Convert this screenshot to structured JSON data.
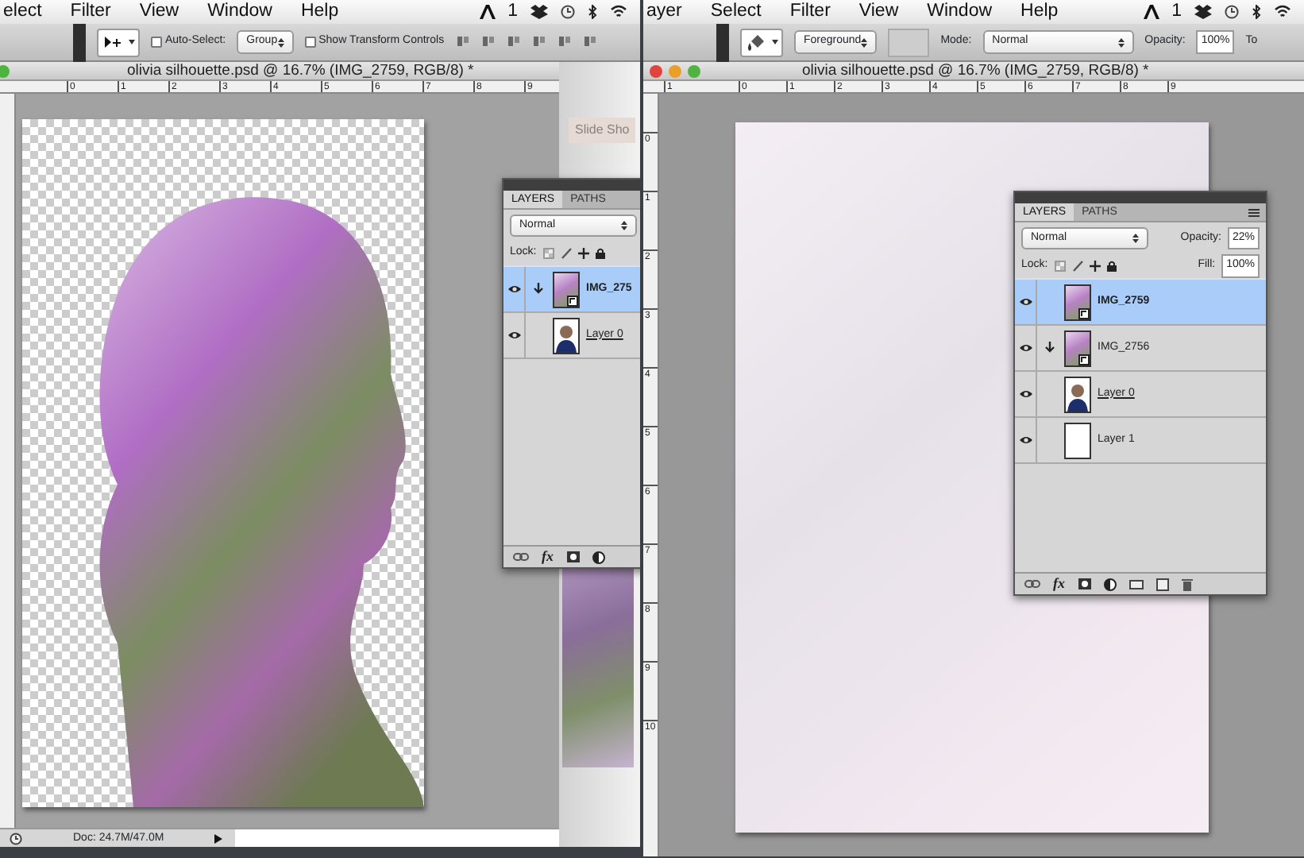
{
  "left_window": {
    "menu_bar": {
      "items": [
        "elect",
        "Filter",
        "View",
        "Window",
        "Help"
      ],
      "badge": "1"
    },
    "options_bar": {
      "controls": [
        {
          "kind": "movetool"
        },
        {
          "kind": "checkbox",
          "label": "Auto-Select:",
          "checked": false
        },
        {
          "kind": "dropdown",
          "value": "Group"
        },
        {
          "kind": "checkbox",
          "label": "Show Transform Controls",
          "checked": false
        }
      ]
    },
    "document": {
      "title": "olivia silhouette.psd @ 16.7% (IMG_2759, RGB/8) *",
      "ruler_marks": [
        "0",
        "1",
        "2",
        "3",
        "4",
        "5",
        "6",
        "7",
        "8",
        "9"
      ],
      "status": "Doc: 24.7M/47.0M"
    },
    "back_window": {
      "button": "Slide Sho"
    },
    "layers_panel": {
      "tabs": [
        {
          "label": "LAYERS",
          "selected": true
        },
        {
          "label": "PATHS",
          "selected": false
        }
      ],
      "blend_mode": "Normal",
      "lock_label": "Lock:",
      "fx": "fx",
      "layers": [
        {
          "name": "IMG_275",
          "selected": true,
          "clipped": true,
          "underlined": false,
          "kind": "photo"
        },
        {
          "name": "Layer 0",
          "selected": false,
          "clipped": false,
          "underlined": true,
          "kind": "portrait"
        }
      ]
    }
  },
  "right_window": {
    "menu_bar": {
      "items": [
        "ayer",
        "Select",
        "Filter",
        "View",
        "Window",
        "Help"
      ],
      "badge": "1"
    },
    "options_bar": {
      "controls": [
        {
          "kind": "buckettool"
        },
        {
          "kind": "dropdown",
          "value": "Foreground"
        },
        {
          "kind": "swatch"
        },
        {
          "kind": "label",
          "text": "Mode:"
        },
        {
          "kind": "select",
          "value": "Normal"
        },
        {
          "kind": "label",
          "text": "Opacity:"
        },
        {
          "kind": "field",
          "value": "100%"
        },
        {
          "kind": "label",
          "text": "To"
        }
      ]
    },
    "document": {
      "title": "olivia silhouette.psd @ 16.7% (IMG_2759, RGB/8) *",
      "ruler_marks": [
        "1",
        "0",
        "1",
        "2",
        "3",
        "4",
        "5",
        "6",
        "7",
        "8",
        "9"
      ],
      "vertical_ruler_marks": [
        "0",
        "1",
        "2",
        "3",
        "4",
        "5",
        "6",
        "7",
        "8",
        "9",
        "10"
      ]
    },
    "layers_panel": {
      "tabs": [
        {
          "label": "LAYERS",
          "selected": true
        },
        {
          "label": "PATHS",
          "selected": false
        }
      ],
      "blend_mode": "Normal",
      "opacity_label": "Opacity:",
      "opacity": "22%",
      "lock_label": "Lock:",
      "fill_label": "Fill:",
      "fill": "100%",
      "fx": "fx",
      "layers": [
        {
          "name": "IMG_2759",
          "selected": true,
          "clipped": false,
          "underlined": false,
          "kind": "photo"
        },
        {
          "name": "IMG_2756",
          "selected": false,
          "clipped": true,
          "underlined": false,
          "kind": "photo"
        },
        {
          "name": "Layer 0",
          "selected": false,
          "clipped": false,
          "underlined": true,
          "kind": "portrait"
        },
        {
          "name": "Layer 1",
          "selected": false,
          "clipped": false,
          "underlined": false,
          "kind": "blank"
        }
      ]
    }
  }
}
